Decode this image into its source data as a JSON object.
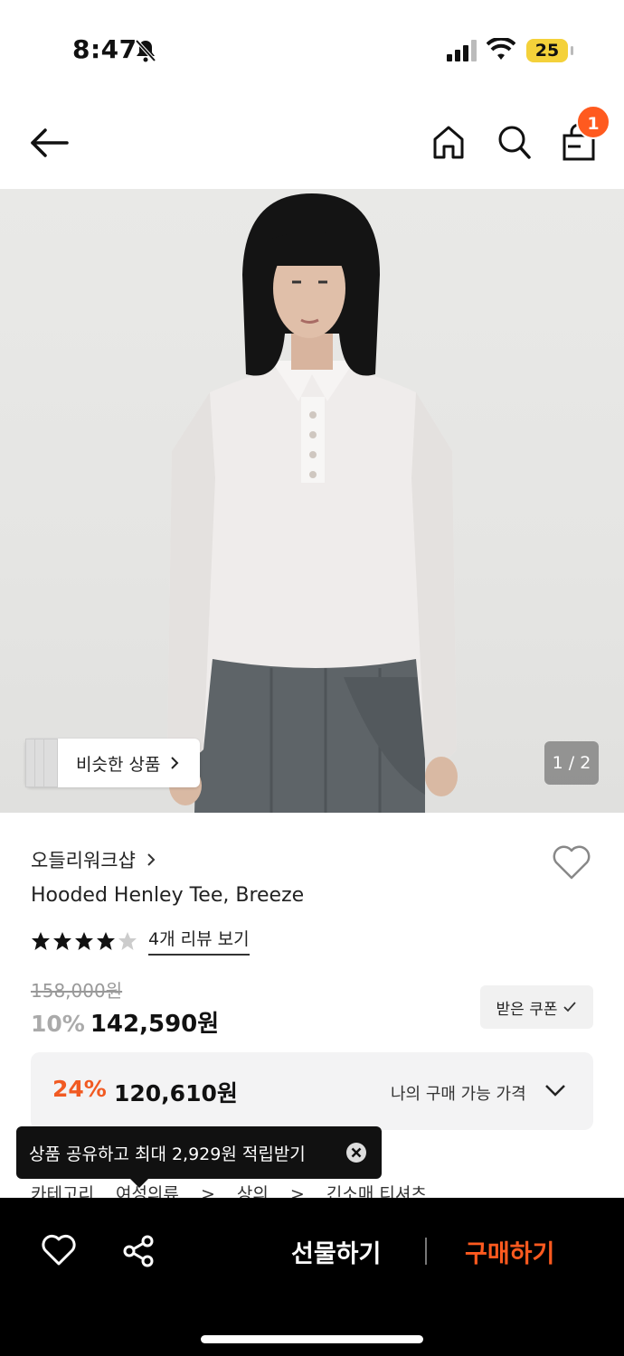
{
  "status_bar": {
    "time": "8:47",
    "battery": "25",
    "icons": [
      "bell-slash-icon",
      "signal-icon",
      "wifi-icon",
      "battery-icon"
    ]
  },
  "header": {
    "icons": [
      "back-arrow-icon",
      "home-icon",
      "search-icon",
      "shopping-bag-icon"
    ],
    "cart_count": "1"
  },
  "hero": {
    "similar_label": "비슷한 상품",
    "page_indicator": "1 / 2"
  },
  "product": {
    "brand": "오들리워크샵",
    "title": "Hooded Henley Tee, Breeze",
    "rating": 4,
    "rating_max": 5,
    "review_link": "4개 리뷰 보기",
    "original_price": "158,000원",
    "discount": "10%",
    "sale_price": "142,590원",
    "coupon_label": "받은 쿠폰"
  },
  "my_price": {
    "discount": "24%",
    "price": "120,610원",
    "label": "나의 구매 가능 가격"
  },
  "tooltip": {
    "text": "상품 공유하고 최대 2,929원 적립받기"
  },
  "category": {
    "label": "카테고리",
    "path": [
      "여성의류",
      "상의",
      "긴소매 티셔츠"
    ]
  },
  "bottom_bar": {
    "gift_label": "선물하기",
    "buy_label": "구매하기"
  },
  "colors": {
    "accent": "#ff5a1f",
    "discount_orange": "#f15a22",
    "bar_bg": "#000000"
  }
}
